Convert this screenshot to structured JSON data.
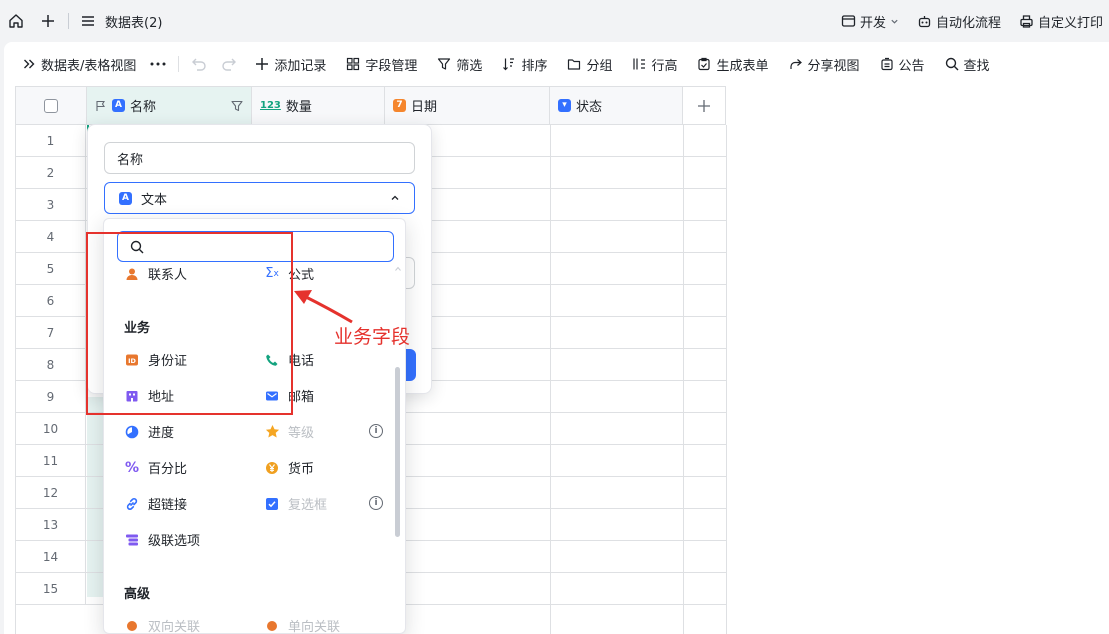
{
  "topbar": {
    "title": "数据表(2)",
    "right_items": [
      {
        "label": "开发",
        "icon": "code-window-icon"
      },
      {
        "label": "自动化流程",
        "icon": "robot-icon"
      },
      {
        "label": "自定义打印",
        "icon": "printer-icon"
      }
    ]
  },
  "toolbar": {
    "view_name": "数据表/表格视图",
    "buttons": [
      "添加记录",
      "字段管理",
      "筛选",
      "排序",
      "分组",
      "行高",
      "生成表单",
      "分享视图",
      "公告",
      "查找"
    ]
  },
  "grid": {
    "columns": [
      {
        "label": "名称",
        "type_badge": "A",
        "color": "#3370ff"
      },
      {
        "label": "数量",
        "type_badge": "123",
        "color": "#13a37f"
      },
      {
        "label": "日期",
        "type_badge": "7",
        "color": "#f5862d"
      },
      {
        "label": "状态",
        "type_badge": "▾",
        "color": "#3370ff"
      }
    ],
    "row_numbers": [
      "1",
      "2",
      "3",
      "4",
      "5",
      "6",
      "7",
      "8",
      "9",
      "10",
      "11",
      "12",
      "13",
      "14",
      "15"
    ]
  },
  "field_panel": {
    "name_value": "名称",
    "type_value": "文本"
  },
  "dropdown": {
    "search_placeholder": "",
    "top_items": [
      {
        "label": "联系人"
      },
      {
        "label": "公式"
      }
    ],
    "section_business": "业务",
    "business_items": [
      {
        "label": "身份证"
      },
      {
        "label": "电话"
      },
      {
        "label": "地址"
      },
      {
        "label": "邮箱"
      }
    ],
    "more_items": [
      {
        "label": "进度"
      },
      {
        "label": "等级"
      },
      {
        "label": "百分比"
      },
      {
        "label": "货币"
      },
      {
        "label": "超链接"
      },
      {
        "label": "复选框"
      },
      {
        "label": "级联选项"
      }
    ],
    "section_advanced": "高级",
    "advanced_items": [
      {
        "label": "双向关联"
      },
      {
        "label": "单向关联"
      }
    ]
  },
  "annotation": {
    "text": "业务字段",
    "color": "#e5322d"
  },
  "colors": {
    "accent": "#3370ff",
    "annotation": "#e5322d",
    "selected_col": "#e6f3f1"
  }
}
